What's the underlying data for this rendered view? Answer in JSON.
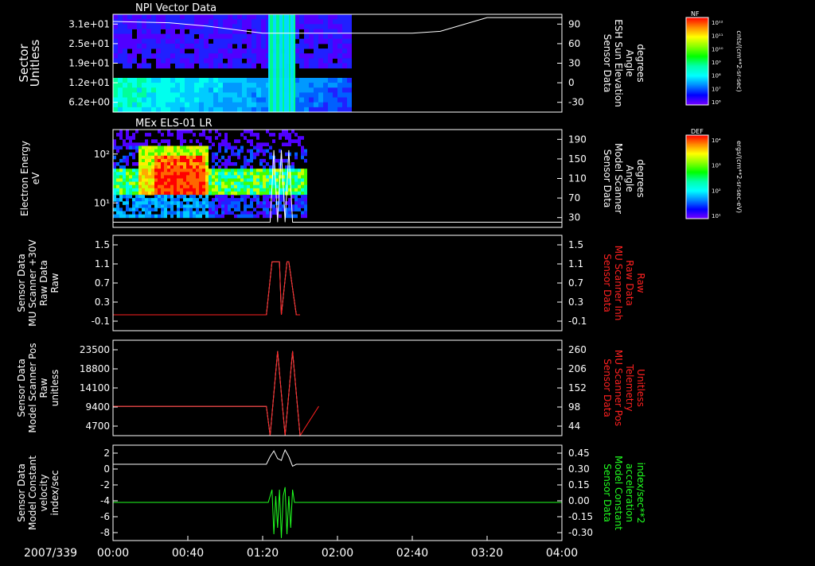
{
  "date_label": "2007/339",
  "time_ticks": [
    "00:00",
    "00:40",
    "01:20",
    "02:00",
    "02:40",
    "03:20",
    "04:00"
  ],
  "panels": [
    {
      "id": "npi",
      "title": "NPI Vector Data",
      "left_label": [
        "Sector",
        "Unitless"
      ],
      "left_ticks": [
        "3.1e+01",
        "2.5e+01",
        "1.9e+01",
        "1.2e+01",
        "6.2e+00"
      ],
      "right_label": [
        "Sensor Data",
        "ESH Sun Elevation",
        "Angle",
        "degrees"
      ],
      "right_ticks": [
        "90",
        "60",
        "30",
        "0",
        "-30"
      ],
      "right_label_color": "#ffffff"
    },
    {
      "id": "els",
      "title": "MEx ELS-01 LR",
      "left_label": [
        "Electron Energy",
        "eV"
      ],
      "left_ticks": [
        "10²",
        "10¹"
      ],
      "right_label": [
        "Sensor Data",
        "Model Scanner",
        "Angle",
        "degrees"
      ],
      "right_ticks": [
        "190",
        "150",
        "110",
        "70",
        "30"
      ],
      "right_label_color": "#ffffff"
    },
    {
      "id": "mu30v",
      "title": "",
      "left_label": [
        "Sensor Data",
        "MU Scanner +30V",
        "Raw Data",
        "Raw"
      ],
      "left_ticks": [
        "1.5",
        "1.1",
        "0.7",
        "0.3",
        "-0.1"
      ],
      "right_label": [
        "Sensor Data",
        "MU Scanner Inh",
        "Raw Data",
        "Raw"
      ],
      "right_ticks": [
        "1.5",
        "1.1",
        "0.7",
        "0.3",
        "-0.1"
      ],
      "right_label_color": "#ff2020"
    },
    {
      "id": "pos",
      "title": "",
      "left_label": [
        "Sensor Data",
        "Model Scanner Pos",
        "Raw",
        "unitless"
      ],
      "left_ticks": [
        "23500",
        "18800",
        "14100",
        "9400",
        "4700"
      ],
      "right_label": [
        "Sensor Data",
        "MU Scanner Pos",
        "Telemetry",
        "Unitless"
      ],
      "right_ticks": [
        "260",
        "206",
        "152",
        "98",
        "44"
      ],
      "right_label_color": "#ff2020"
    },
    {
      "id": "vel",
      "title": "",
      "left_label": [
        "Sensor Data",
        "Model Constant",
        "velocity",
        "index/sec"
      ],
      "left_ticks": [
        "2",
        "0",
        "-2",
        "-4",
        "-6",
        "-8"
      ],
      "right_label": [
        "Sensor Data",
        "Model Constant",
        "acceleration",
        "index/sec**2"
      ],
      "right_ticks": [
        "0.45",
        "0.30",
        "0.15",
        "0.00",
        "-0.15",
        "-0.30"
      ],
      "right_label_color": "#20ff20"
    }
  ],
  "colorbars": [
    {
      "id": "nf",
      "name": "NF",
      "unit": "cnts/(cm**2-sr-sec)",
      "ticks": [
        "10¹²",
        "10¹¹",
        "10¹⁰",
        "10⁹",
        "10⁸",
        "10⁷",
        "10⁶"
      ]
    },
    {
      "id": "def",
      "name": "DEF",
      "unit": "ergs/(cm**2-sr-sec-eV)",
      "ticks": [
        "10⁴",
        "10³",
        "10²",
        "10¹"
      ]
    }
  ],
  "chart_data": [
    {
      "type": "heatmap",
      "title": "NPI Vector Data",
      "ylabel": "Sector Unitless",
      "y_tick_labels": [
        "3.1e+01",
        "2.5e+01",
        "1.9e+01",
        "1.2e+01",
        "6.2e+00"
      ],
      "x_range": [
        "00:00",
        "04:00"
      ],
      "data_extent": [
        "00:00",
        "02:07"
      ],
      "overlay_line": {
        "name": "Sensor Data ESH Sun Elevation Angle degrees",
        "ylim": [
          -60,
          90
        ],
        "x_min": [
          0,
          30,
          50,
          80,
          120,
          160,
          175,
          200,
          240
        ],
        "y": [
          79,
          77,
          72,
          61,
          61,
          61,
          64,
          85,
          85
        ]
      }
    },
    {
      "type": "heatmap",
      "title": "MEx ELS-01 LR",
      "ylabel": "Electron Energy eV",
      "y_scale": "log",
      "x_range": [
        "00:00",
        "04:00"
      ],
      "data_extent": [
        "00:00",
        "01:43"
      ],
      "overlay_line": {
        "name": "Sensor Data Model Scanner Angle degrees",
        "ylim": [
          0,
          190
        ],
        "x_min": [
          0,
          84,
          86,
          88,
          90,
          92,
          94,
          96,
          240
        ],
        "y": [
          10,
          10,
          150,
          10,
          150,
          10,
          150,
          10,
          10
        ]
      }
    },
    {
      "type": "line",
      "x_range_min": [
        0,
        240
      ],
      "ylim": [
        -0.3,
        1.5
      ],
      "series": [
        {
          "name": "Sensor Data MU Scanner +30V Raw Data Raw",
          "color": "#ffffff",
          "x_min": [
            0,
            82,
            85,
            89,
            90,
            93,
            94,
            98,
            100
          ],
          "y": [
            0,
            0,
            1,
            1,
            0,
            1,
            1,
            0,
            0
          ]
        },
        {
          "name": "Sensor Data MU Scanner Inh Raw Data Raw",
          "color": "#ff2020",
          "x_min": [
            0,
            82,
            85,
            89,
            90,
            93,
            94,
            98,
            100
          ],
          "y": [
            0,
            0,
            1,
            1,
            0,
            1,
            1,
            0,
            0
          ]
        }
      ]
    },
    {
      "type": "line",
      "x_range_min": [
        0,
        240
      ],
      "series": [
        {
          "name": "Sensor Data Model Scanner Pos Raw unitless",
          "color": "#ffffff",
          "ylim": [
            0,
            23500
          ],
          "x_min": [
            0,
            82,
            84,
            88,
            92,
            96,
            100
          ],
          "y": [
            7200,
            7200,
            0,
            20800,
            0,
            20800,
            0
          ]
        },
        {
          "name": "Sensor Data MU Scanner Pos Telemetry Unitless",
          "color": "#ff2020",
          "ylim": [
            0,
            260
          ],
          "x_min": [
            0,
            82,
            84,
            88,
            92,
            96,
            100,
            110
          ],
          "y": [
            80,
            80,
            0,
            230,
            0,
            230,
            0,
            80
          ]
        }
      ]
    },
    {
      "type": "line",
      "x_range_min": [
        0,
        240
      ],
      "series": [
        {
          "name": "Sensor Data Model Constant velocity index/sec",
          "color": "#ffffff",
          "ylim": [
            -8,
            2
          ],
          "x_min": [
            0,
            82,
            84,
            86,
            88,
            90,
            91,
            92,
            94,
            96,
            98,
            240
          ],
          "y": [
            0,
            0,
            0.8,
            1.4,
            0.6,
            0.4,
            1.0,
            1.5,
            0.8,
            -0.2,
            0,
            0
          ]
        },
        {
          "name": "Sensor Data Model Constant acceleration index/sec**2",
          "color": "#20ff20",
          "ylim": [
            -0.3,
            0.45
          ],
          "x_min": [
            0,
            83,
            85,
            86,
            87,
            88,
            89,
            90,
            91,
            92,
            93,
            94,
            95,
            96,
            97,
            240
          ],
          "y": [
            0,
            0,
            0.1,
            -0.25,
            0.05,
            -0.2,
            0.1,
            -0.28,
            0.05,
            0.12,
            -0.25,
            0.05,
            -0.2,
            0.1,
            0,
            0
          ]
        }
      ]
    }
  ]
}
